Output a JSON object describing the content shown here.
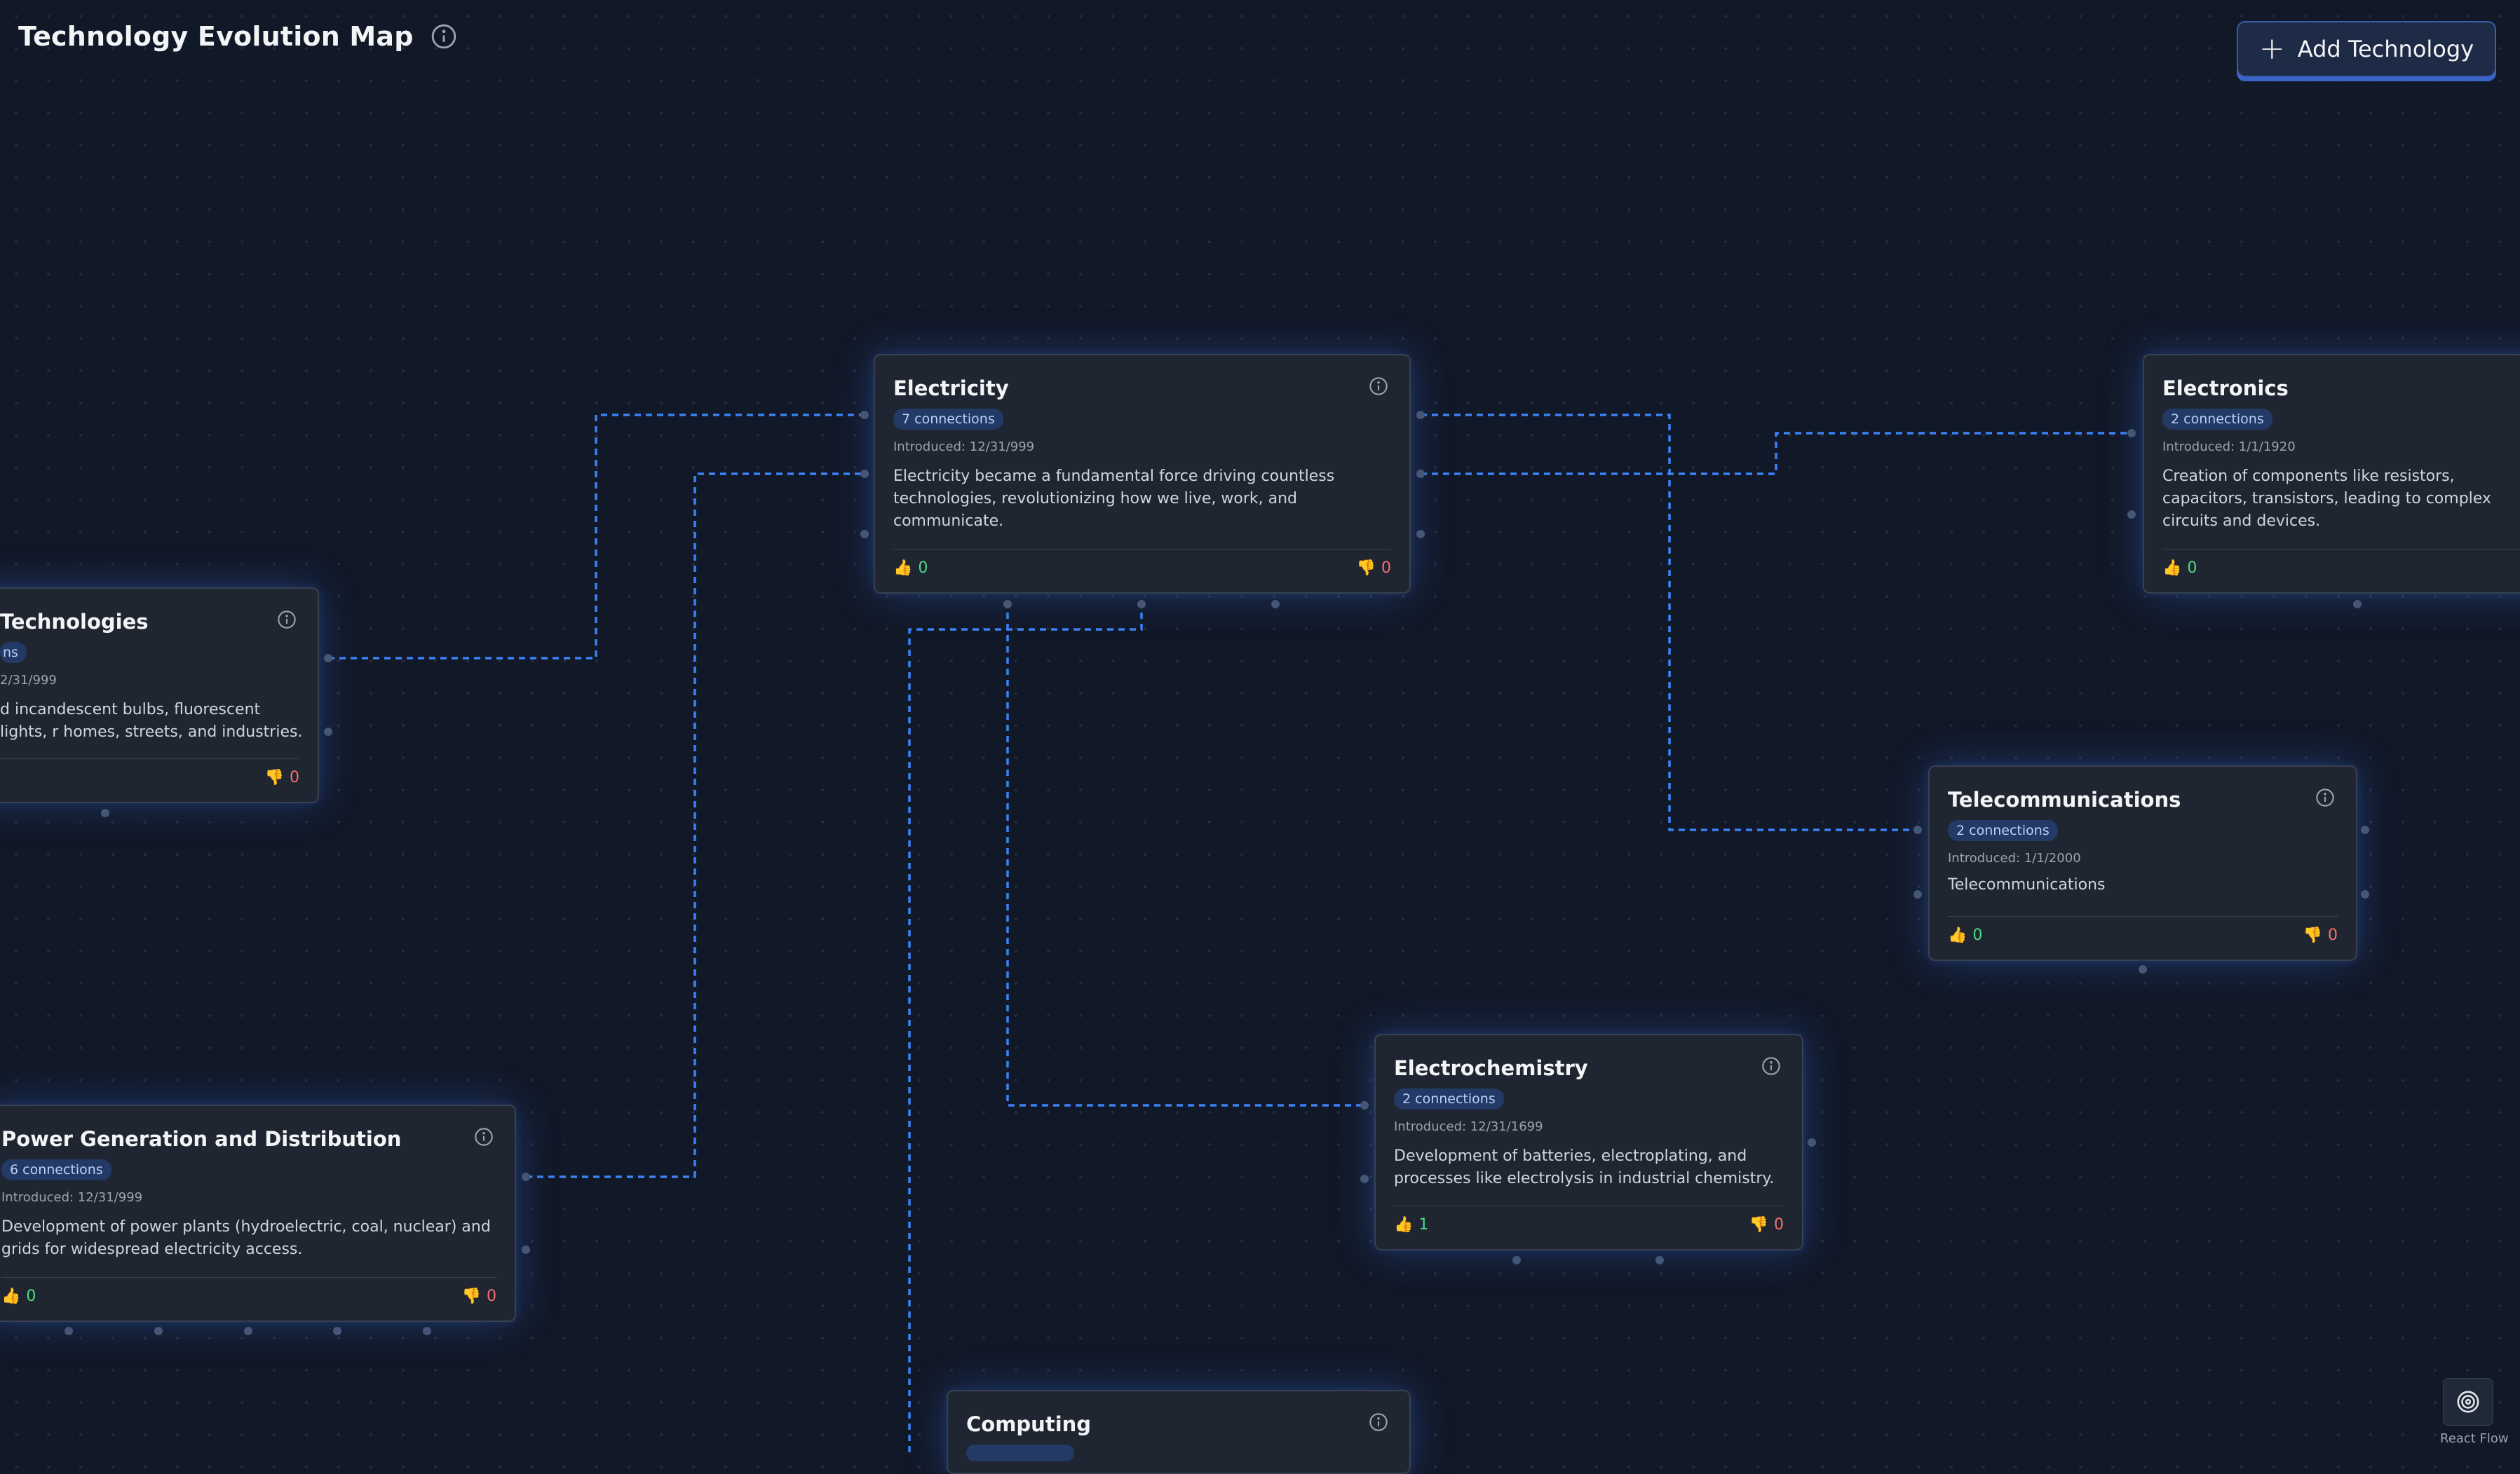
{
  "header": {
    "title": "Technology Evolution Map",
    "add_label": "Add Technology"
  },
  "nodes": {
    "electricity": {
      "name": "Electricity",
      "badge": "7 connections",
      "introduced": "Introduced: 12/31/999",
      "description": "Electricity became a fundamental force driving countless technologies, revolutionizing how we live, work, and communicate.",
      "up": "0",
      "down": "0"
    },
    "electronics": {
      "name": "Electronics",
      "badge": "2 connections",
      "introduced": "Introduced: 1/1/1920",
      "description": "Creation of components like resistors, capacitors, transistors, leading to complex circuits and devices.",
      "up": "0"
    },
    "lighting": {
      "name": "Technologies",
      "badge": "ns",
      "introduced": "2/31/999",
      "description": "d incandescent bulbs, fluorescent lights, r homes, streets, and industries.",
      "down": "0"
    },
    "telecom": {
      "name": "Telecommunications",
      "badge": "2 connections",
      "introduced": "Introduced: 1/1/2000",
      "description": "Telecommunications",
      "up": "0",
      "down": "0"
    },
    "electrochem": {
      "name": "Electrochemistry",
      "badge": "2 connections",
      "introduced": "Introduced: 12/31/1699",
      "description": "Development of batteries, electroplating, and processes like electrolysis in industrial chemistry.",
      "up": "1",
      "down": "0"
    },
    "power": {
      "name": "Power Generation and Distribution",
      "badge": "6 connections",
      "introduced": "Introduced: 12/31/999",
      "description": "Development of power plants (hydroelectric, coal, nuclear) and grids for widespread electricity access.",
      "up": "0",
      "down": "0"
    },
    "computing": {
      "name": "Computing"
    }
  },
  "attribution": "React Flow",
  "colors": {
    "background": "#111827",
    "edge": "#3b82f6",
    "badge": "#233a66",
    "upvote": "#4ade80",
    "downvote": "#f87171"
  }
}
